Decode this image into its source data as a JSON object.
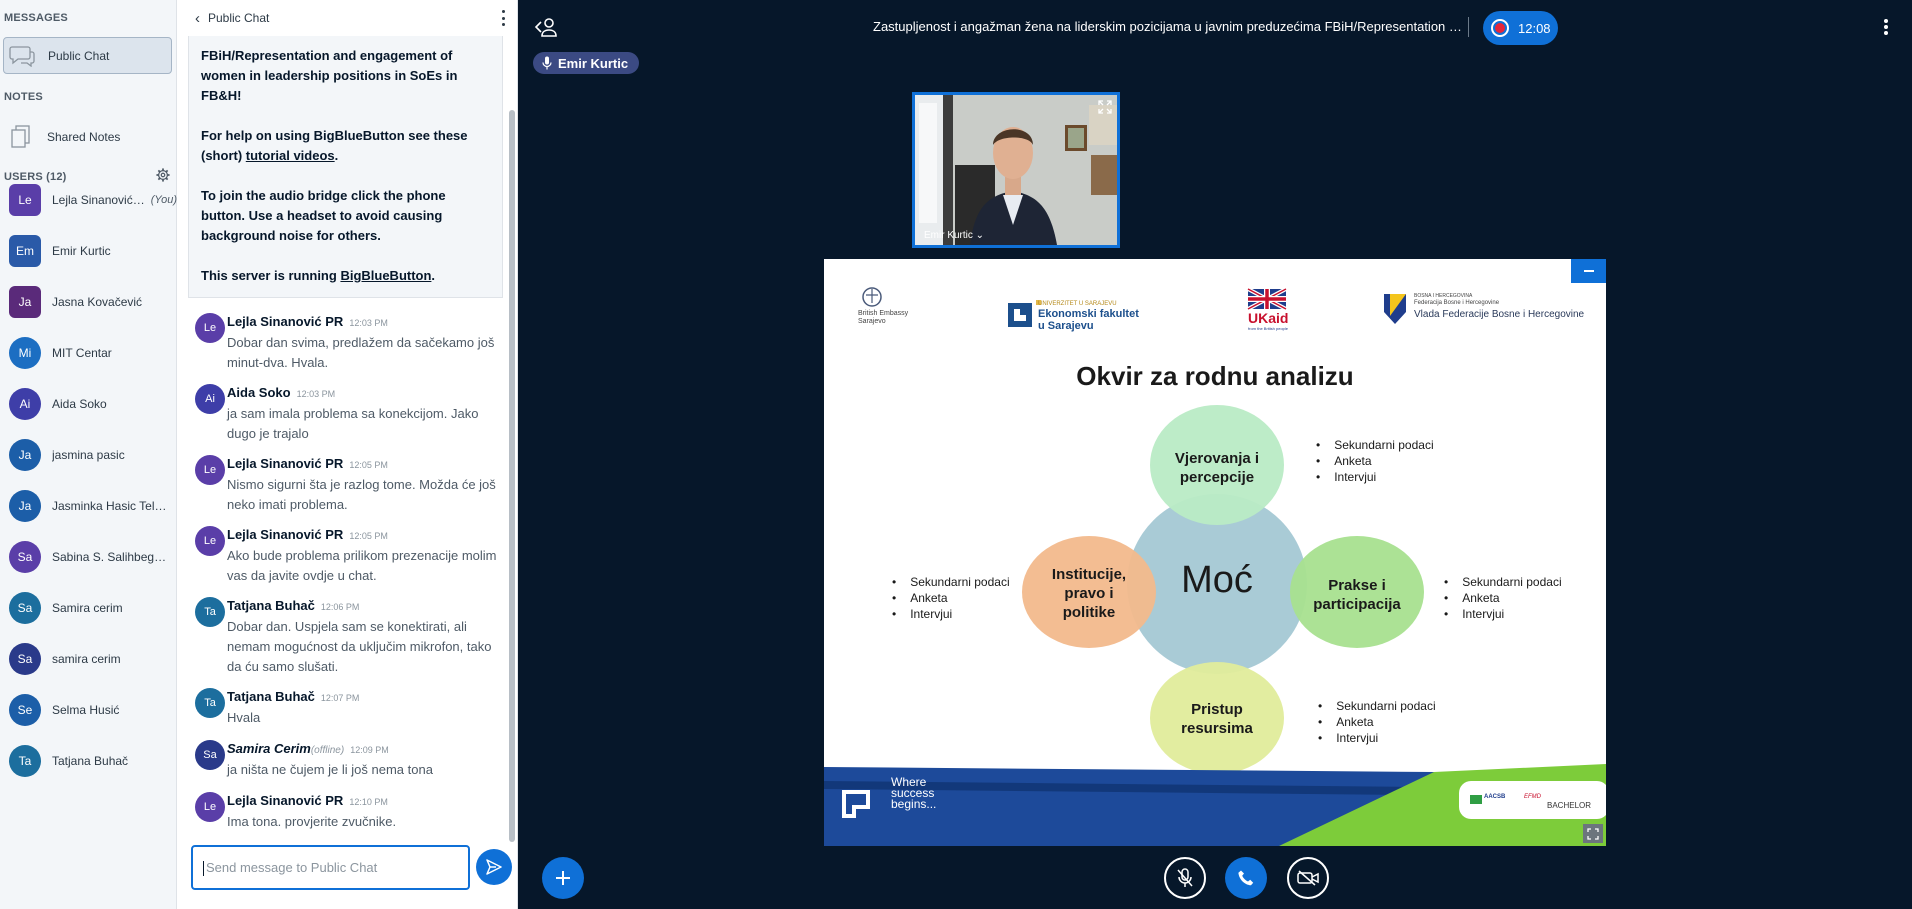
{
  "sidebar": {
    "messages_title": "MESSAGES",
    "public_chat": "Public Chat",
    "notes_title": "NOTES",
    "shared_notes": "Shared Notes",
    "users_title": "USERS (12)",
    "users": [
      {
        "initials": "Le",
        "name": "Lejla Sinanović …",
        "you": "(You)",
        "color": "#5a3ea8",
        "status": "muted"
      },
      {
        "initials": "Em",
        "name": "Emir Kurtic",
        "you": "",
        "color": "#2a5aa8",
        "status": "listen"
      },
      {
        "initials": "Ja",
        "name": "Jasna Kovačević",
        "you": "",
        "color": "#5a2a7a",
        "status": "muted"
      },
      {
        "initials": "Mi",
        "name": "MIT Centar",
        "you": "",
        "color": "#1c6ec2",
        "status": "muted"
      },
      {
        "initials": "Ai",
        "name": "Aida Soko",
        "you": "",
        "color": "#3e3ea8",
        "status": "muted"
      },
      {
        "initials": "Ja",
        "name": "jasmina pasic",
        "you": "",
        "color": "#1c5ea8",
        "status": "muted"
      },
      {
        "initials": "Ja",
        "name": "Jasminka Hasic Telal…",
        "you": "",
        "color": "#1c5ea8",
        "status": "listen"
      },
      {
        "initials": "Sa",
        "name": "Sabina S. Salihbegovic",
        "you": "",
        "color": "#5a3ea8",
        "status": "muted"
      },
      {
        "initials": "Sa",
        "name": "Samira cerim",
        "you": "",
        "color": "#1c6e9e",
        "status": "listen"
      },
      {
        "initials": "Sa",
        "name": "samira cerim",
        "you": "",
        "color": "#2a3a8a",
        "status": "none"
      },
      {
        "initials": "Se",
        "name": "Selma Husić",
        "you": "",
        "color": "#1c5ea8",
        "status": "none"
      },
      {
        "initials": "Ta",
        "name": "Tatjana Buhač",
        "you": "",
        "color": "#1c6e9e",
        "status": "listen"
      }
    ]
  },
  "chat": {
    "title": "Public Chat",
    "welcome": {
      "line1": "FBiH/Representation and engagement of women in leadership positions in SoEs in FB&H!",
      "help_pre": "For help on using BigBlueButton see these (short) ",
      "help_link": "tutorial videos",
      "help_post": ".",
      "audio": "To join the audio bridge click the phone button. Use a headset to avoid causing background noise for others.",
      "server_pre": "This server is running ",
      "server_link": "BigBlueButton",
      "server_post": "."
    },
    "messages": [
      {
        "initials": "Le",
        "color": "#5a3ea8",
        "name": "Lejla Sinanović PR",
        "offline": "",
        "time": "12:03 PM",
        "text": "Dobar dan svima, predlažem da sačekamo još minut-dva. Hvala."
      },
      {
        "initials": "Ai",
        "color": "#3e3ea8",
        "name": "Aida Soko",
        "offline": "",
        "time": "12:03 PM",
        "text": "ja sam imala problema sa konekcijom. Jako dugo je trajalo"
      },
      {
        "initials": "Le",
        "color": "#5a3ea8",
        "name": "Lejla Sinanović PR",
        "offline": "",
        "time": "12:05 PM",
        "text": "Nismo sigurni šta je razlog tome. Možda će još neko imati problema."
      },
      {
        "initials": "Le",
        "color": "#5a3ea8",
        "name": "Lejla Sinanović PR",
        "offline": "",
        "time": "12:05 PM",
        "text": "Ako bude problema prilikom prezenacije molim vas da javite ovdje u chat."
      },
      {
        "initials": "Ta",
        "color": "#1c6e9e",
        "name": "Tatjana Buhač",
        "offline": "",
        "time": "12:06 PM",
        "text": "Dobar dan. Uspjela sam se konektirati, ali nemam mogućnost da uključim mikrofon, tako da ću samo slušati."
      },
      {
        "initials": "Ta",
        "color": "#1c6e9e",
        "name": "Tatjana Buhač",
        "offline": "",
        "time": "12:07 PM",
        "text": "Hvala"
      },
      {
        "initials": "Sa",
        "color": "#2a3a8a",
        "name": "Samira Cerim",
        "offline": "(offline)",
        "time": "12:09 PM",
        "text": "ja ništa ne čujem je li još nema tona"
      },
      {
        "initials": "Le",
        "color": "#5a3ea8",
        "name": "Lejla Sinanović PR",
        "offline": "",
        "time": "12:10 PM",
        "text": "Ima tona. provjerite zvučnike."
      }
    ],
    "input_placeholder": "Send message to Public Chat"
  },
  "main": {
    "meeting_title": "Zastupljenost i angažman žena na liderskim pozicijama u javnim preduzećima FBiH/Representation …",
    "record_time": "12:08",
    "talker": "Emir Kurtic",
    "webcam_name": "Emir Kurtic ⌄"
  },
  "slide": {
    "logos": {
      "british": "British Embassy Sarajevo",
      "efsa1": "UNIVERZITET U SARAJEVU",
      "efsa2": "Ekonomski fakultet u Sarajevu",
      "ukaid": "UKaid",
      "ukaid_sub": "from the British people",
      "fbih1": "BOSNA I HERCEGOVINA",
      "fbih2": "Federacija Bosne i Hercegovine",
      "fbih3": "Vlada Federacije Bosne i Hercegovine"
    },
    "title": "Okvir za rodnu analizu",
    "center": "Moć",
    "top": [
      "Vjerovanja i",
      "percepcije"
    ],
    "left": [
      "Institucije,",
      "pravo i",
      "politike"
    ],
    "right": [
      "Prakse i",
      "participacija"
    ],
    "bottom": [
      "Pristup",
      "resursima"
    ],
    "bullet_items": [
      "Sekundarni podaci",
      "Anketa",
      "Intervjui"
    ],
    "footer_left": [
      "Where",
      "success",
      "begins..."
    ],
    "footer_badge1": "AACSB",
    "footer_badge2": "EFMD",
    "footer_badge3": "BACHELOR"
  }
}
